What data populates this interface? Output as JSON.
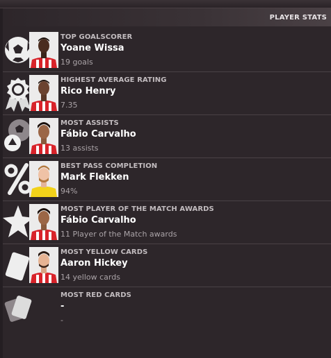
{
  "panel": {
    "title": "PLAYER STATS"
  },
  "stats": [
    {
      "category": "TOP GOALSCORER",
      "player": "Yoane Wissa",
      "value": "19 goals",
      "icon": "football-icon"
    },
    {
      "category": "HIGHEST AVERAGE RATING",
      "player": "Rico Henry",
      "value": "7.35",
      "icon": "rosette-icon"
    },
    {
      "category": "MOST ASSISTS",
      "player": "Fábio Carvalho",
      "value": "13 assists",
      "icon": "assist-icon"
    },
    {
      "category": "BEST PASS COMPLETION",
      "player": "Mark Flekken",
      "value": "94%",
      "icon": "percent-icon"
    },
    {
      "category": "MOST PLAYER OF THE MATCH AWARDS",
      "player": "Fábio Carvalho",
      "value": "11 Player of the Match awards",
      "icon": "star-icon"
    },
    {
      "category": "MOST YELLOW CARDS",
      "player": "Aaron Hickey",
      "value": "14 yellow cards",
      "icon": "yellow-card-icon"
    },
    {
      "category": "MOST RED CARDS",
      "player": "-",
      "value": "-",
      "icon": "red-card-icon"
    }
  ],
  "colors": {
    "background": "#2d262a",
    "kit_red": "#d8232a",
    "kit_white": "#ffffff",
    "keeper_kit": "#f2d21a"
  }
}
